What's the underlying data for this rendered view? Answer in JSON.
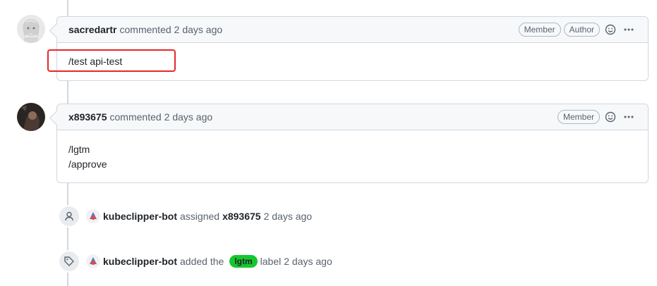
{
  "comments": [
    {
      "author": "sacredartr",
      "action": "commented",
      "time": "2 days ago",
      "badges": [
        "Member",
        "Author"
      ],
      "body_lines": [
        "/test api-test"
      ]
    },
    {
      "author": "x893675",
      "action": "commented",
      "time": "2 days ago",
      "badges": [
        "Member"
      ],
      "body_lines": [
        "/lgtm",
        "/approve"
      ]
    }
  ],
  "events": [
    {
      "icon": "person-icon",
      "actor": "kubeclipper-bot",
      "verb": "assigned",
      "target": "x893675",
      "time": "2 days ago"
    },
    {
      "icon": "tag-icon",
      "actor": "kubeclipper-bot",
      "verb": "added the",
      "label": "lgtm",
      "label_color": "#16c72e",
      "suffix": "label",
      "time": "2 days ago"
    }
  ],
  "colors": {
    "border": "#d0d7de",
    "header_bg": "#f6f8fa",
    "highlight": "#e5282a"
  }
}
